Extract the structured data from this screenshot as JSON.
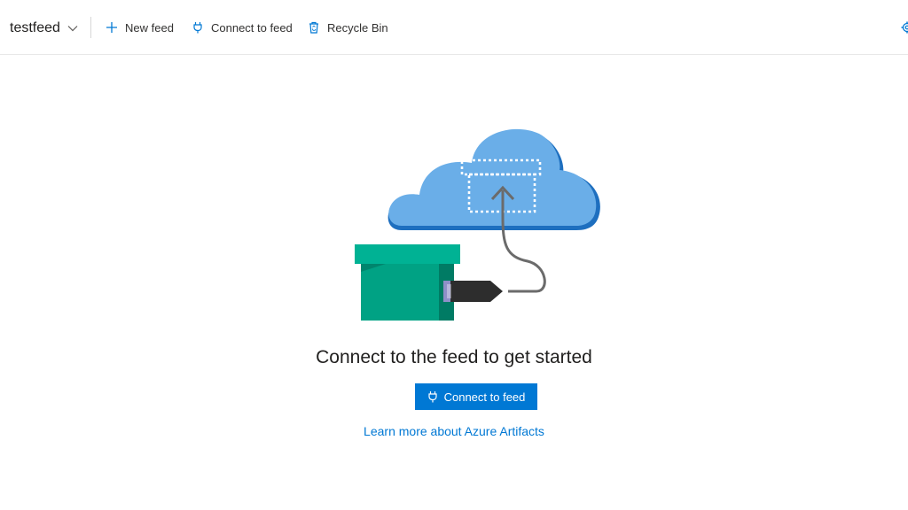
{
  "toolbar": {
    "feed_name": "testfeed",
    "new_feed_label": "New feed",
    "connect_label": "Connect to feed",
    "recycle_label": "Recycle Bin",
    "accent_color": "#0078d4"
  },
  "icons": {
    "feed_dropdown": "chevron-down-icon",
    "new_feed": "plus-icon",
    "connect": "plug-icon",
    "recycle": "recycle-bin-icon",
    "settings": "gear-icon"
  },
  "empty_state": {
    "title": "Connect to the feed to get started",
    "button_label": "Connect to feed",
    "learn_more_link": "Learn more about Azure Artifacts"
  }
}
